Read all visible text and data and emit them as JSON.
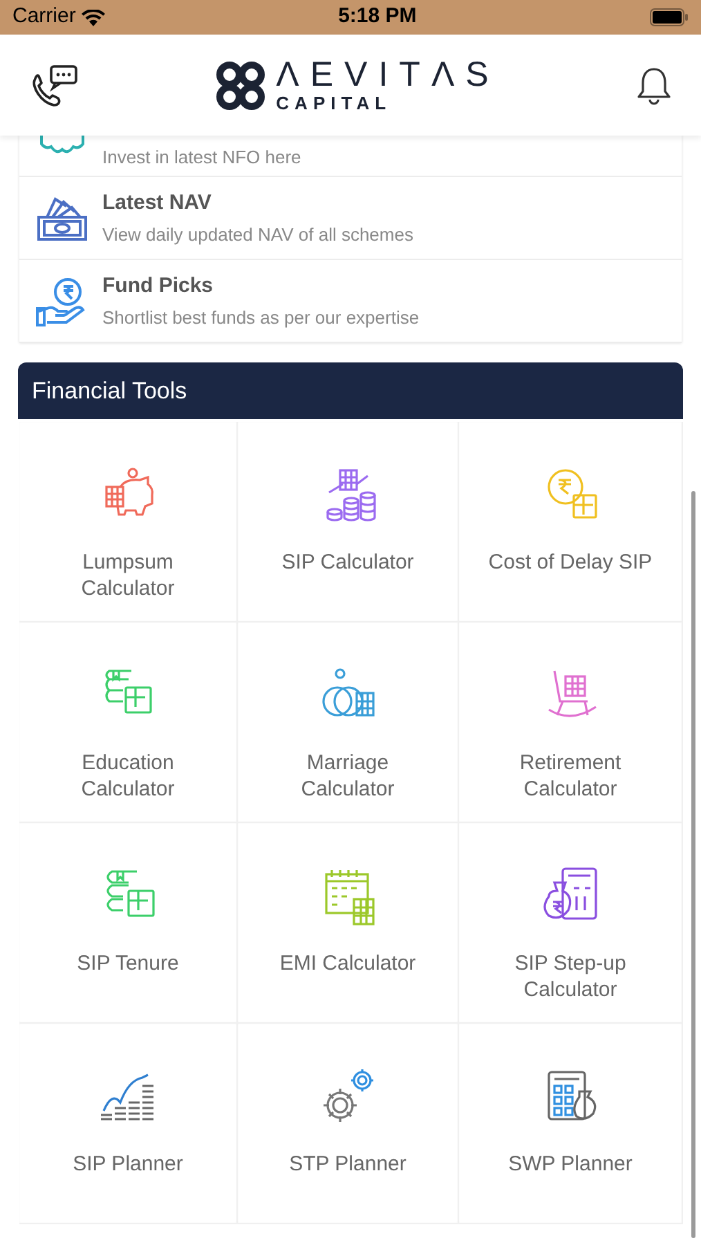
{
  "status_bar": {
    "carrier": "Carrier",
    "time": "5:18 PM"
  },
  "header": {
    "logo_title": "ΛEVITΛS",
    "logo_subtitle": "CAPITAL"
  },
  "menu_items": [
    {
      "subtitle": "Invest in latest NFO here"
    },
    {
      "title": "Latest NAV",
      "subtitle": "View daily updated NAV of all schemes"
    },
    {
      "title": "Fund Picks",
      "subtitle": "Shortlist best funds as per our expertise"
    }
  ],
  "financial_tools": {
    "title": "Financial Tools",
    "tools": [
      {
        "label": "Lumpsum Calculator"
      },
      {
        "label": "SIP Calculator"
      },
      {
        "label": "Cost of Delay SIP"
      },
      {
        "label": "Education Calculator"
      },
      {
        "label": "Marriage Calculator"
      },
      {
        "label": "Retirement Calculator"
      },
      {
        "label": "SIP Tenure"
      },
      {
        "label": "EMI Calculator"
      },
      {
        "label": "SIP Step-up Calculator"
      },
      {
        "label": "SIP Planner"
      },
      {
        "label": "STP Planner"
      },
      {
        "label": "SWP Planner"
      }
    ]
  }
}
